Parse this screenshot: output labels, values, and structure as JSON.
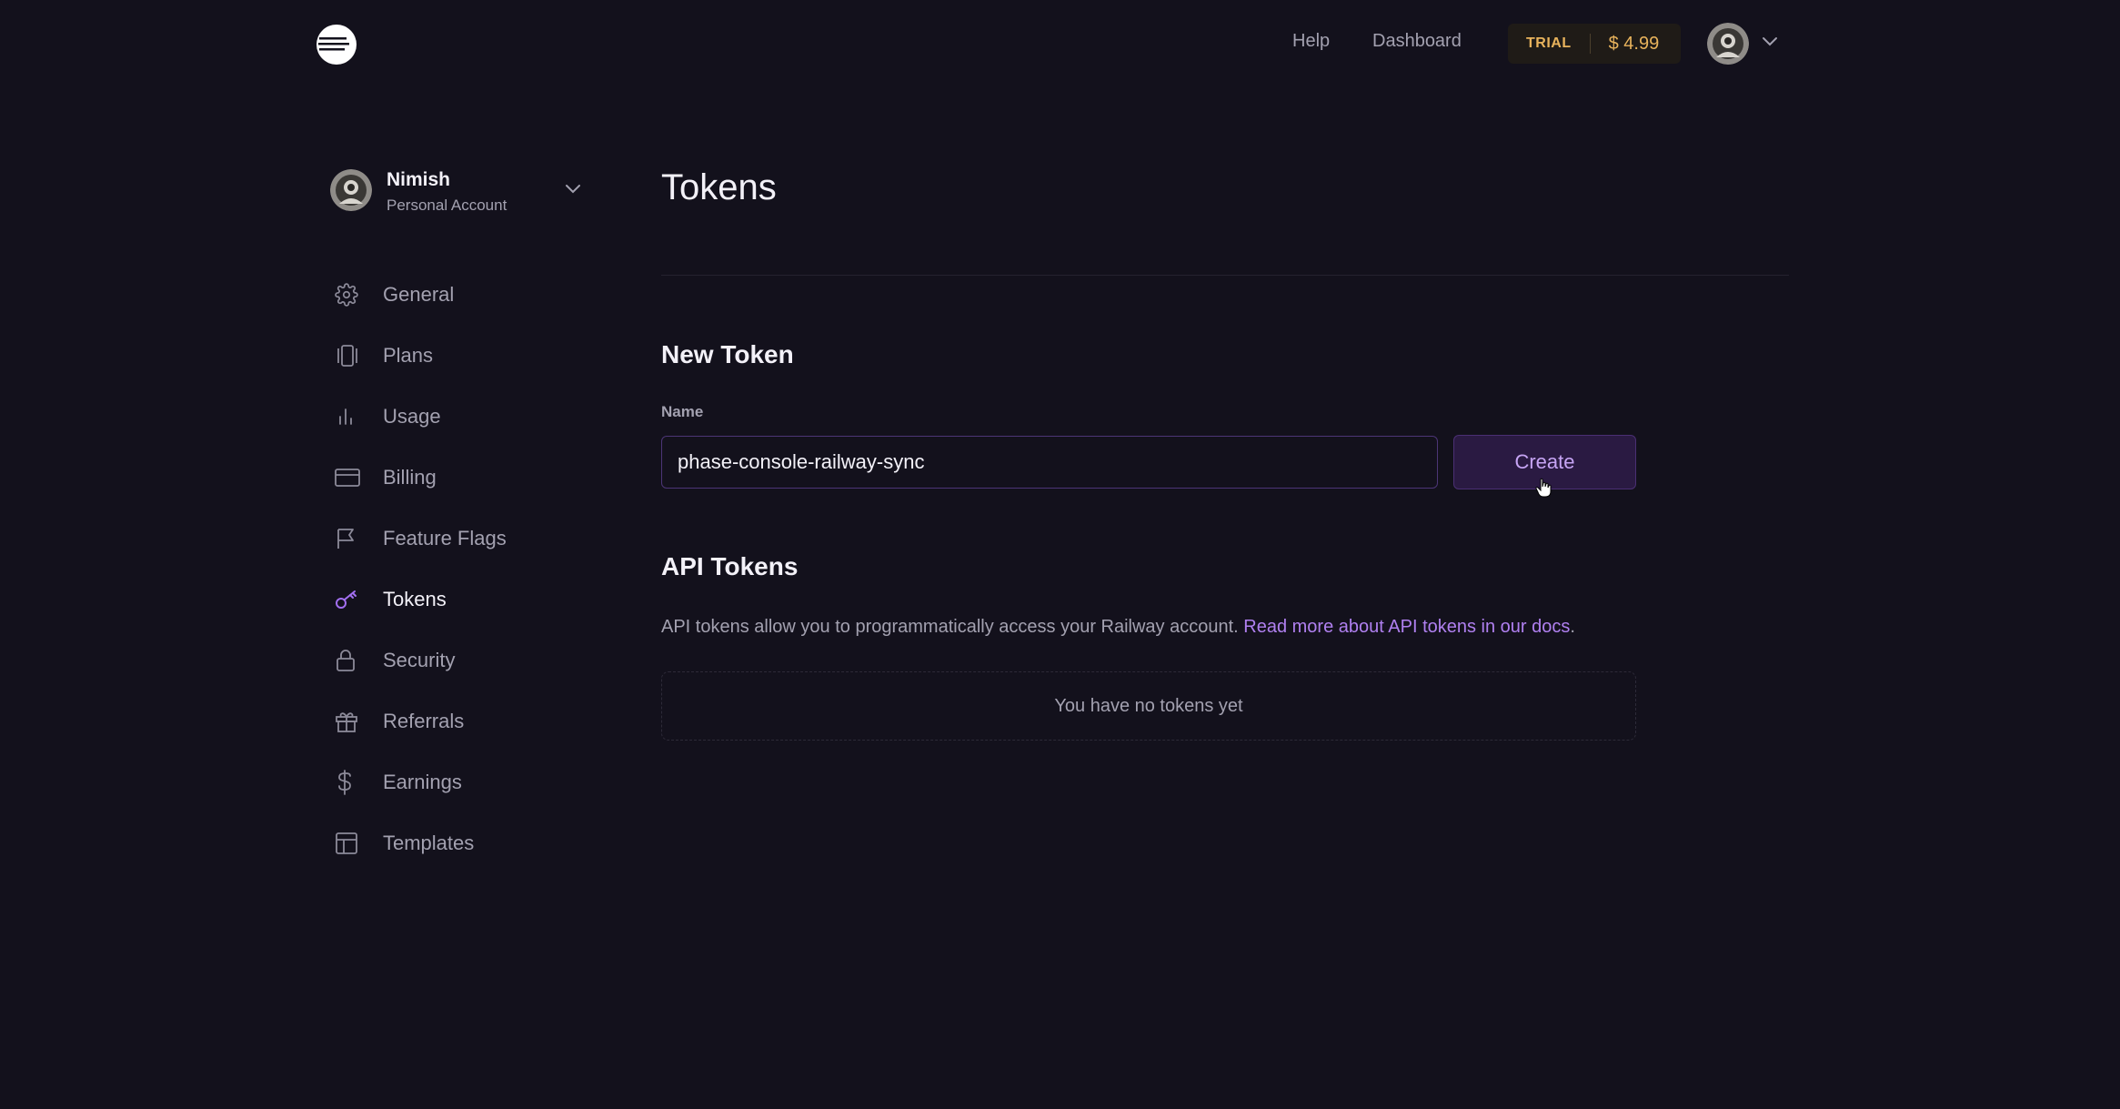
{
  "header": {
    "help_label": "Help",
    "dashboard_label": "Dashboard",
    "trial_tag": "TRIAL",
    "trial_amount": "$ 4.99"
  },
  "account": {
    "name": "Nimish",
    "type": "Personal Account"
  },
  "sidebar": {
    "items": [
      {
        "label": "General",
        "icon": "gear-icon"
      },
      {
        "label": "Plans",
        "icon": "plans-icon"
      },
      {
        "label": "Usage",
        "icon": "bar-chart-icon"
      },
      {
        "label": "Billing",
        "icon": "credit-card-icon"
      },
      {
        "label": "Feature Flags",
        "icon": "flag-icon"
      },
      {
        "label": "Tokens",
        "icon": "key-icon",
        "active": true
      },
      {
        "label": "Security",
        "icon": "lock-icon"
      },
      {
        "label": "Referrals",
        "icon": "gift-icon"
      },
      {
        "label": "Earnings",
        "icon": "dollar-icon"
      },
      {
        "label": "Templates",
        "icon": "template-icon"
      }
    ]
  },
  "main": {
    "title": "Tokens",
    "new_token": {
      "title": "New Token",
      "name_label": "Name",
      "name_value": "phase-console-railway-sync",
      "create_label": "Create"
    },
    "api_tokens": {
      "title": "API Tokens",
      "description": "API tokens allow you to programmatically access your Railway account.",
      "docs_link": "Read more about API tokens in our docs",
      "description_end": ".",
      "empty_text": "You have no tokens yet"
    }
  },
  "colors": {
    "background": "#13111c",
    "accent": "#b080f0",
    "trial": "#e8b35c"
  }
}
